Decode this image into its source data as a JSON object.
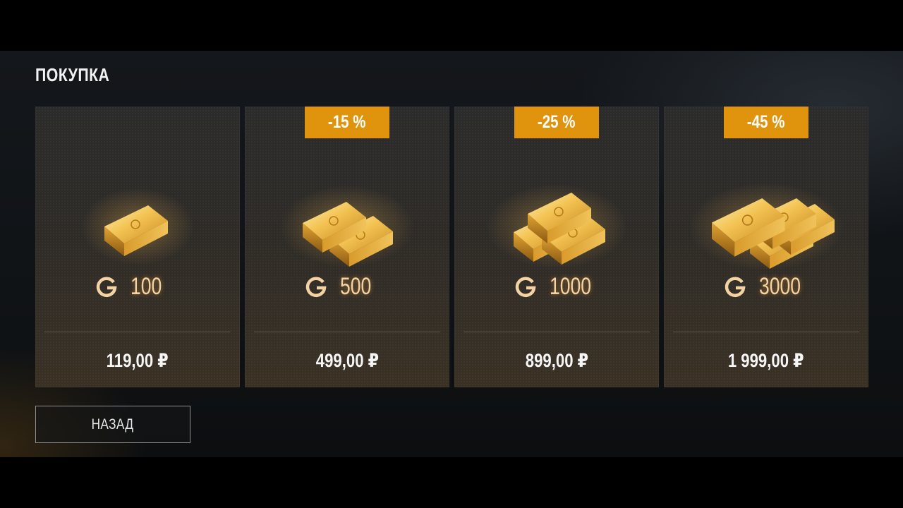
{
  "page": {
    "title": "ПОКУПКА"
  },
  "colors": {
    "discount_badge": "#e0940d",
    "gold_text": "#f3d2a3",
    "price_text": "#f6f6f6"
  },
  "cards": [
    {
      "discount": "",
      "gold_amount": "100",
      "price": "119,00 ₽",
      "currency_icon": "gold-coin-g-icon"
    },
    {
      "discount": "-15 %",
      "gold_amount": "500",
      "price": "499,00 ₽",
      "currency_icon": "gold-coin-g-icon"
    },
    {
      "discount": "-25 %",
      "gold_amount": "1000",
      "price": "899,00 ₽",
      "currency_icon": "gold-coin-g-icon"
    },
    {
      "discount": "-45 %",
      "gold_amount": "3000",
      "price": "1 999,00 ₽",
      "currency_icon": "gold-coin-g-icon"
    }
  ],
  "footer": {
    "back_label": "НАЗАД"
  }
}
